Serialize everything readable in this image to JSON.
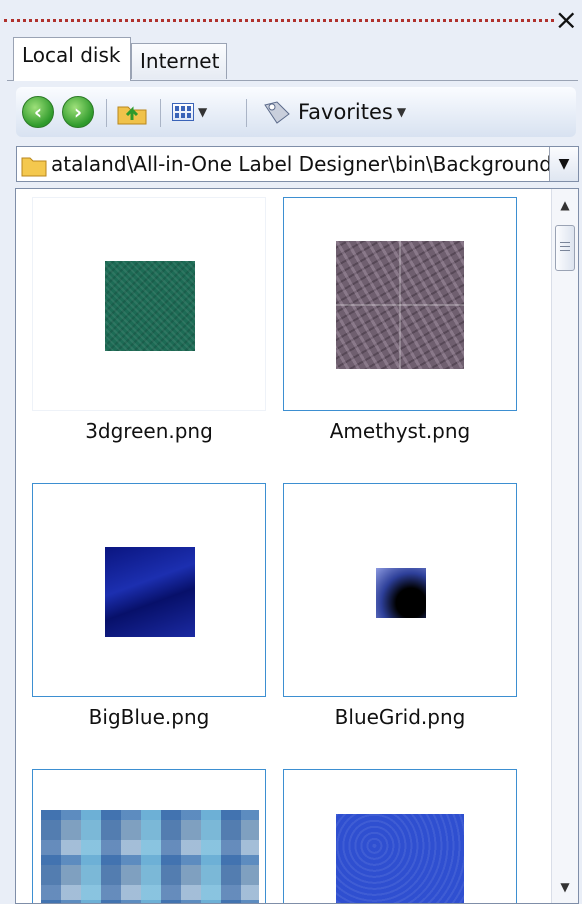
{
  "window": {
    "close_symbol": "×"
  },
  "tabs": [
    {
      "label": "Local disk",
      "active": true
    },
    {
      "label": "Internet",
      "active": false
    }
  ],
  "toolbar": {
    "back_icon": "back-arrow-icon",
    "forward_icon": "forward-arrow-icon",
    "up_icon": "folder-up-icon",
    "views_icon": "views-icon",
    "favorites_label": "Favorites"
  },
  "address": {
    "path": "ataland\\All-in-One Label Designer\\bin\\Backgrounds"
  },
  "files": [
    {
      "name": "3dgreen.png",
      "selected": false,
      "color": "#1d6b55"
    },
    {
      "name": "Amethyst.png",
      "selected": true,
      "color": "#6f5f6f"
    },
    {
      "name": "BigBlue.png",
      "selected": true,
      "color": "#0b1a8c"
    },
    {
      "name": "BlueGrid.png",
      "selected": true,
      "color": "#2c3c8c"
    },
    {
      "name": "",
      "selected": true,
      "color": "#7fa0c0"
    },
    {
      "name": "",
      "selected": true,
      "color": "#2f4fd0"
    }
  ],
  "colors": {
    "selection_border": "#3d8fd1",
    "accent_green": "#2e9a2b"
  }
}
